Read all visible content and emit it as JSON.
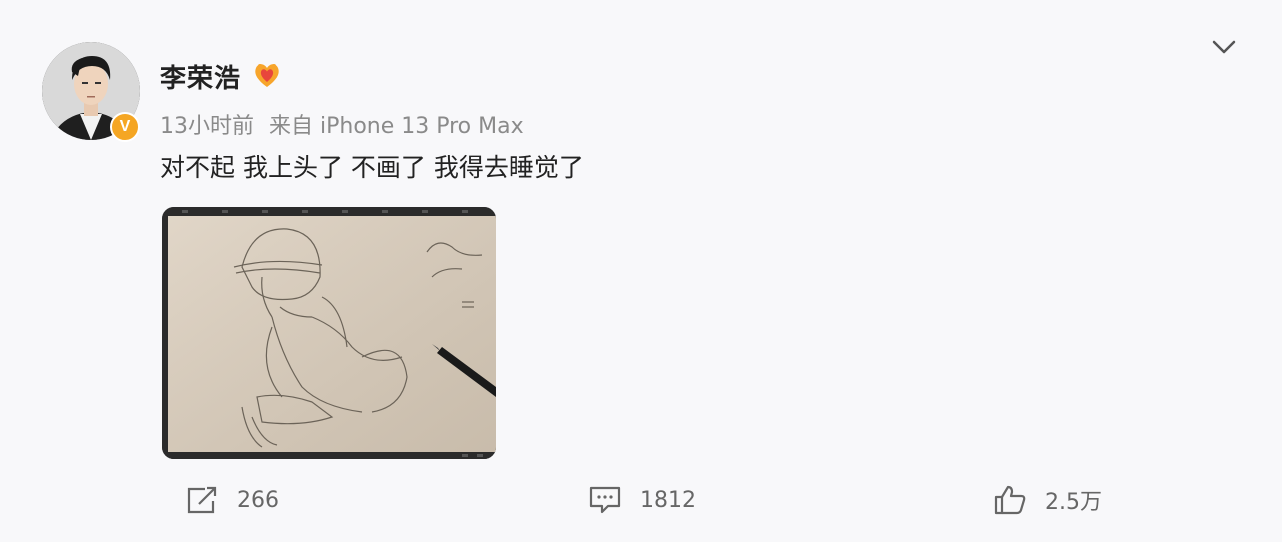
{
  "post": {
    "user_name": "李荣浩",
    "timestamp": "13小时前",
    "source": "来自 iPhone 13 Pro Max",
    "content": "对不起 我上头了 不画了 我得去睡觉了",
    "verified_badge": "V"
  },
  "actions": {
    "repost_count": "266",
    "comment_count": "1812",
    "like_count": "2.5万"
  },
  "icons": {
    "menu": "chevron-down-icon",
    "repost": "repost-icon",
    "comment": "comment-icon",
    "like": "thumbs-up-icon",
    "member": "member-heart-badge-icon"
  },
  "colors": {
    "background": "#f8f8fa",
    "verified": "#f5a623",
    "member_badge": "#f7a52b"
  }
}
